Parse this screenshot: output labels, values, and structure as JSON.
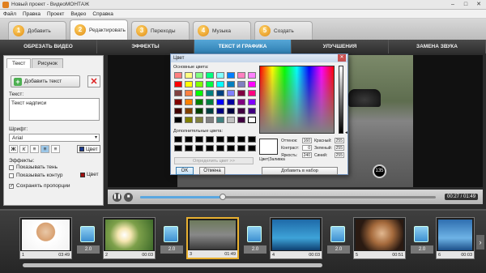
{
  "window": {
    "title": "Новый проект - ВидеоМОНТАЖ"
  },
  "menu": [
    "Файл",
    "Правка",
    "Проект",
    "Видео",
    "Справка"
  ],
  "steps": [
    {
      "num": "1",
      "label": "Добавить"
    },
    {
      "num": "2",
      "label": "Редактировать"
    },
    {
      "num": "3",
      "label": "Переходы"
    },
    {
      "num": "4",
      "label": "Музыка"
    },
    {
      "num": "5",
      "label": "Создать"
    }
  ],
  "subtabs": [
    "ОБРЕЗАТЬ ВИДЕО",
    "ЭФФЕКТЫ",
    "ТЕКСТ И ГРАФИКА",
    "УЛУЧШЕНИЯ",
    "ЗАМЕНА ЗВУКА"
  ],
  "left_panel": {
    "tabs": [
      "Текст",
      "Рисунок"
    ],
    "add_text_label": "Добавить текст",
    "text_label": "Текст:",
    "text_value": "Текст надписи",
    "font_label": "Шрифт:",
    "font_value": "Arial",
    "color_label": "Цвет",
    "effects_label": "Эффекты:",
    "shadow_label": "Показывать тень",
    "outline_label": "Показывать контур",
    "outline_color_label": "Цвет",
    "keep_ratio_label": "Сохранять пропорции",
    "text_color": "#1a3a8f",
    "outline_color": "#a01010"
  },
  "preview": {
    "badge": "135"
  },
  "player": {
    "time": "00:27 / 01:49",
    "progress": 0.28
  },
  "timeline": {
    "clips": [
      {
        "index": "1",
        "time": "03:49"
      },
      {
        "index": "2",
        "time": "00:03"
      },
      {
        "index": "3",
        "time": "01:49"
      },
      {
        "index": "4",
        "time": "00:03"
      },
      {
        "index": "5",
        "time": "00:51"
      },
      {
        "index": "6",
        "time": "00:03"
      }
    ],
    "transition_durations": [
      "2.0",
      "2.0",
      "2.0",
      "2.0",
      "2.0",
      "2.0"
    ]
  },
  "color_dialog": {
    "title": "Цвет",
    "basic_label": "Основные цвета:",
    "custom_label": "Дополнительные цвета:",
    "define_label": "Определить цвет >>",
    "hue_label": "Оттенок:",
    "hue": "160",
    "sat_label": "Контраст:",
    "sat": "0",
    "lum_label": "Яркость:",
    "lum": "240",
    "red_label": "Красный:",
    "red": "255",
    "green_label": "Зеленый:",
    "green": "255",
    "blue_label": "Синий:",
    "blue": "255",
    "color_solid_label": "Цвет|Заливка",
    "ok_label": "OK",
    "cancel_label": "Отмена",
    "add_custom_label": "Добавить в набор",
    "basic_colors": [
      "#ff8080",
      "#ffff80",
      "#80ff80",
      "#00ff80",
      "#80ffff",
      "#0080ff",
      "#ff80c0",
      "#ff80ff",
      "#ff0000",
      "#ffff00",
      "#80ff00",
      "#00ff40",
      "#00ffff",
      "#0080c0",
      "#8080c0",
      "#ff00ff",
      "#804040",
      "#ff8040",
      "#00ff00",
      "#008080",
      "#004080",
      "#8080ff",
      "#800040",
      "#ff0080",
      "#800000",
      "#ff8000",
      "#008000",
      "#008040",
      "#0000ff",
      "#0000a0",
      "#800080",
      "#8000ff",
      "#400000",
      "#804000",
      "#004000",
      "#004040",
      "#000080",
      "#000040",
      "#400040",
      "#400080",
      "#000000",
      "#808000",
      "#808040",
      "#808080",
      "#408080",
      "#c0c0c0",
      "#400040",
      "#ffffff"
    ]
  }
}
